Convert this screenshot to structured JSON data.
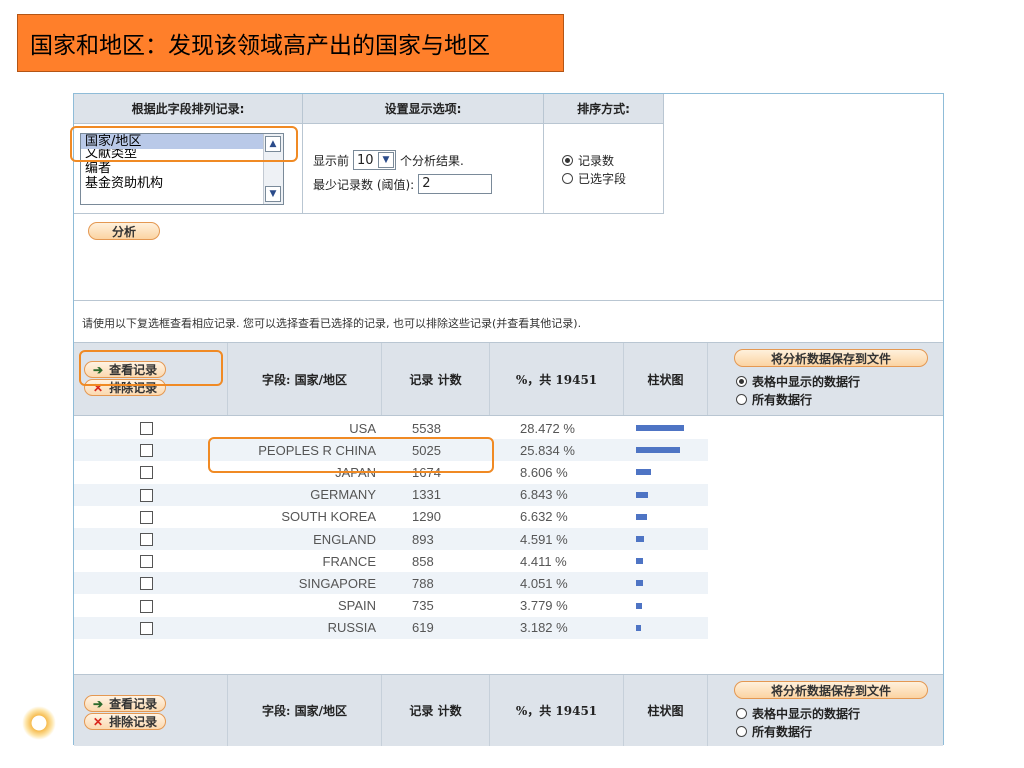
{
  "slide_title": "国家和地区：发现该领域高产出的国家与地区",
  "options": {
    "headers": {
      "sort_field": "根据此字段排列记录:",
      "display": "设置显示选项:",
      "sort_order": "排序方式:"
    },
    "field_list": [
      "国家/地区",
      "文献类型",
      "编者",
      "基金资助机构"
    ],
    "selected_field": "国家/地区",
    "show_top_prefix": "显示前",
    "show_top_value": "10",
    "show_top_suffix": "个分析结果.",
    "min_records_label": "最少记录数 (阈值):",
    "min_records_value": "2",
    "sort_by_count": "记录数",
    "sort_by_field": "已选字段",
    "analyze_button": "分析"
  },
  "hint_text": "请使用以下复选框查看相应记录. 您可以选择查看已选择的记录, 也可以排除这些记录(并查看其他记录).",
  "table": {
    "view_records": "查看记录",
    "exclude_records": "排除记录",
    "col_field": "字段: 国家/地区",
    "col_count": "记录 计数",
    "col_percent": "%，共 19451",
    "col_bar": "柱状图",
    "save_button": "将分析数据保存到文件",
    "save_opt_rows": "表格中显示的数据行",
    "save_opt_all": "所有数据行",
    "rows": [
      {
        "country": "USA",
        "count": "5538",
        "percent": "28.472 %",
        "pct": 28.472
      },
      {
        "country": "PEOPLES R CHINA",
        "count": "5025",
        "percent": "25.834 %",
        "pct": 25.834
      },
      {
        "country": "JAPAN",
        "count": "1674",
        "percent": "8.606 %",
        "pct": 8.606
      },
      {
        "country": "GERMANY",
        "count": "1331",
        "percent": "6.843 %",
        "pct": 6.843
      },
      {
        "country": "SOUTH KOREA",
        "count": "1290",
        "percent": "6.632 %",
        "pct": 6.632
      },
      {
        "country": "ENGLAND",
        "count": "893",
        "percent": "4.591 %",
        "pct": 4.591
      },
      {
        "country": "FRANCE",
        "count": "858",
        "percent": "4.411 %",
        "pct": 4.411
      },
      {
        "country": "SINGAPORE",
        "count": "788",
        "percent": "4.051 %",
        "pct": 4.051
      },
      {
        "country": "SPAIN",
        "count": "735",
        "percent": "3.779 %",
        "pct": 3.779
      },
      {
        "country": "RUSSIA",
        "count": "619",
        "percent": "3.182 %",
        "pct": 3.182
      }
    ]
  },
  "colors": {
    "title_bg": "#ff7f2a",
    "highlight": "#f08a24",
    "bar": "#4e74c4",
    "header_bg": "#dde3ea"
  }
}
